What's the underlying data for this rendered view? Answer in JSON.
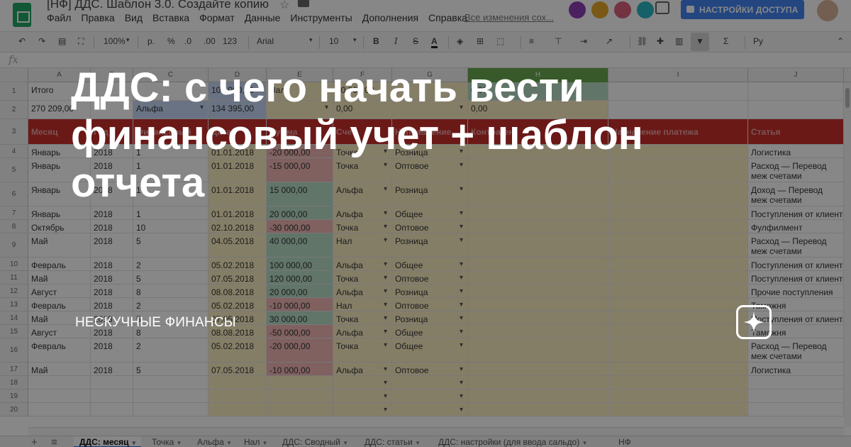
{
  "sheet": {
    "doc_title": "[НФ] ДДС. Шаблон 3.0. Создайте копию",
    "menu": [
      "Файл",
      "Правка",
      "Вид",
      "Вставка",
      "Формат",
      "Данные",
      "Инструменты",
      "Дополнения",
      "Справка"
    ],
    "last_edit": "Все изменения сох...",
    "share_label": "НАСТРОЙКИ ДОСТУПА",
    "toolbar": {
      "zoom": "100%",
      "currency": "р.",
      "percent": "%",
      "dec_less": ".0",
      "dec_more": ".00",
      "more_formats": "123",
      "font": "Arial",
      "font_size": "10",
      "bold": "B",
      "italic": "I",
      "strike": "S",
      "text_color": "A",
      "input_tools": "Ру"
    },
    "fx_label": "fx",
    "columns": [
      "A",
      "B",
      "C",
      "D",
      "E",
      "F",
      "G",
      "H",
      "I",
      "J"
    ],
    "rows": [
      {
        "n": "1",
        "cells": [
          "Итого",
          "",
          "",
          "105 000,00",
          "Нал",
          "30 000,00",
          "",
          "0,00",
          "",
          ""
        ]
      },
      {
        "n": "2",
        "cells": [
          "270 209,00",
          "",
          "Альфа",
          "134 395,00",
          "",
          "0,00",
          "",
          "0,00",
          "",
          ""
        ]
      },
      {
        "n": "3",
        "cells": [
          "Месяц",
          "Год",
          "Финансовый",
          "Дата",
          "Сумма",
          "Счет",
          "Направление",
          "Контрагент",
          "Назначение платежа",
          "Статья"
        ]
      },
      {
        "n": "4",
        "cells": [
          "Январь",
          "2018",
          "1",
          "01.01.2018",
          "-20 000,00",
          "Точка",
          "Розница",
          "",
          "",
          "Логистика"
        ]
      },
      {
        "n": "5",
        "cells": [
          "Январь",
          "2018",
          "1",
          "01.01.2018",
          "-15 000,00",
          "Точка",
          "Оптовое",
          "",
          "",
          "Расход — Перевод меж счетами"
        ]
      },
      {
        "n": "6",
        "cells": [
          "Январь",
          "2018",
          "1",
          "01.01.2018",
          "15 000,00",
          "Альфа",
          "Розница",
          "",
          "",
          "Доход — Перевод меж счетами"
        ]
      },
      {
        "n": "7",
        "cells": [
          "Январь",
          "2018",
          "1",
          "01.01.2018",
          "20 000,00",
          "Альфа",
          "Общее",
          "",
          "",
          "Поступления от клиента"
        ]
      },
      {
        "n": "8",
        "cells": [
          "Октябрь",
          "2018",
          "10",
          "02.10.2018",
          "-30 000,00",
          "Точка",
          "Оптовое",
          "",
          "",
          "Фулфилмент"
        ]
      },
      {
        "n": "9",
        "cells": [
          "Май",
          "2018",
          "5",
          "04.05.2018",
          "40 000,00",
          "Нал",
          "Розница",
          "",
          "",
          "Расход — Перевод меж счетами"
        ]
      },
      {
        "n": "10",
        "cells": [
          "Февраль",
          "2018",
          "2",
          "05.02.2018",
          "100 000,00",
          "Альфа",
          "Общее",
          "",
          "",
          "Поступления от клиента"
        ]
      },
      {
        "n": "11",
        "cells": [
          "Май",
          "2018",
          "5",
          "07.05.2018",
          "120 000,00",
          "Точка",
          "Оптовое",
          "",
          "",
          "Поступления от клиента"
        ]
      },
      {
        "n": "12",
        "cells": [
          "Август",
          "2018",
          "8",
          "08.08.2018",
          "20 000,00",
          "Альфа",
          "Розница",
          "",
          "",
          "Прочие поступления"
        ]
      },
      {
        "n": "13",
        "cells": [
          "Февраль",
          "2018",
          "2",
          "05.02.2018",
          "-10 000,00",
          "Нал",
          "Оптовое",
          "",
          "",
          "Таможня"
        ]
      },
      {
        "n": "14",
        "cells": [
          "Май",
          "2018",
          "5",
          "07.05.2018",
          "30 000,00",
          "Точка",
          "Розница",
          "",
          "",
          "Поступления от клиента"
        ]
      },
      {
        "n": "15",
        "cells": [
          "Август",
          "2018",
          "8",
          "08.08.2018",
          "-50 000,00",
          "Альфа",
          "Общее",
          "",
          "",
          "Таможня"
        ]
      },
      {
        "n": "16",
        "cells": [
          "Февраль",
          "2018",
          "2",
          "05.02.2018",
          "-20 000,00",
          "Точка",
          "Общее",
          "",
          "",
          "Расход — Перевод меж счетами"
        ]
      },
      {
        "n": "17",
        "cells": [
          "Май",
          "2018",
          "5",
          "07.05.2018",
          "-10 000,00",
          "Альфа",
          "Оптовое",
          "",
          "",
          "Логистика"
        ]
      },
      {
        "n": "18",
        "cells": [
          "",
          "",
          "",
          "",
          "",
          "",
          "",
          "",
          "",
          ""
        ]
      },
      {
        "n": "19",
        "cells": [
          "",
          "",
          "",
          "",
          "",
          "",
          "",
          "",
          "",
          ""
        ]
      },
      {
        "n": "20",
        "cells": [
          "",
          "",
          "",
          "",
          "",
          "",
          "",
          "",
          "",
          ""
        ]
      }
    ],
    "tabs": [
      "ДДС: месяц",
      "Точка",
      "Альфа",
      "Нал",
      "ДДС: Сводный",
      "ДДС: статьи",
      "ДДС: настройки (для ввода сальдо)",
      "НФ"
    ],
    "colors": {
      "header_red": "#c9302c",
      "yellow": "#fbefc2",
      "green": "#b7ddc6",
      "red": "#f1b8b6",
      "blue": "#c9daf8"
    }
  },
  "overlay": {
    "headline": "ДДС: с чего начать вести финансовый учет + шаблон отчета",
    "brand": "НЕСКУЧНЫЕ ФИНАНСЫ",
    "brand_icon": "sparkle-icon"
  }
}
